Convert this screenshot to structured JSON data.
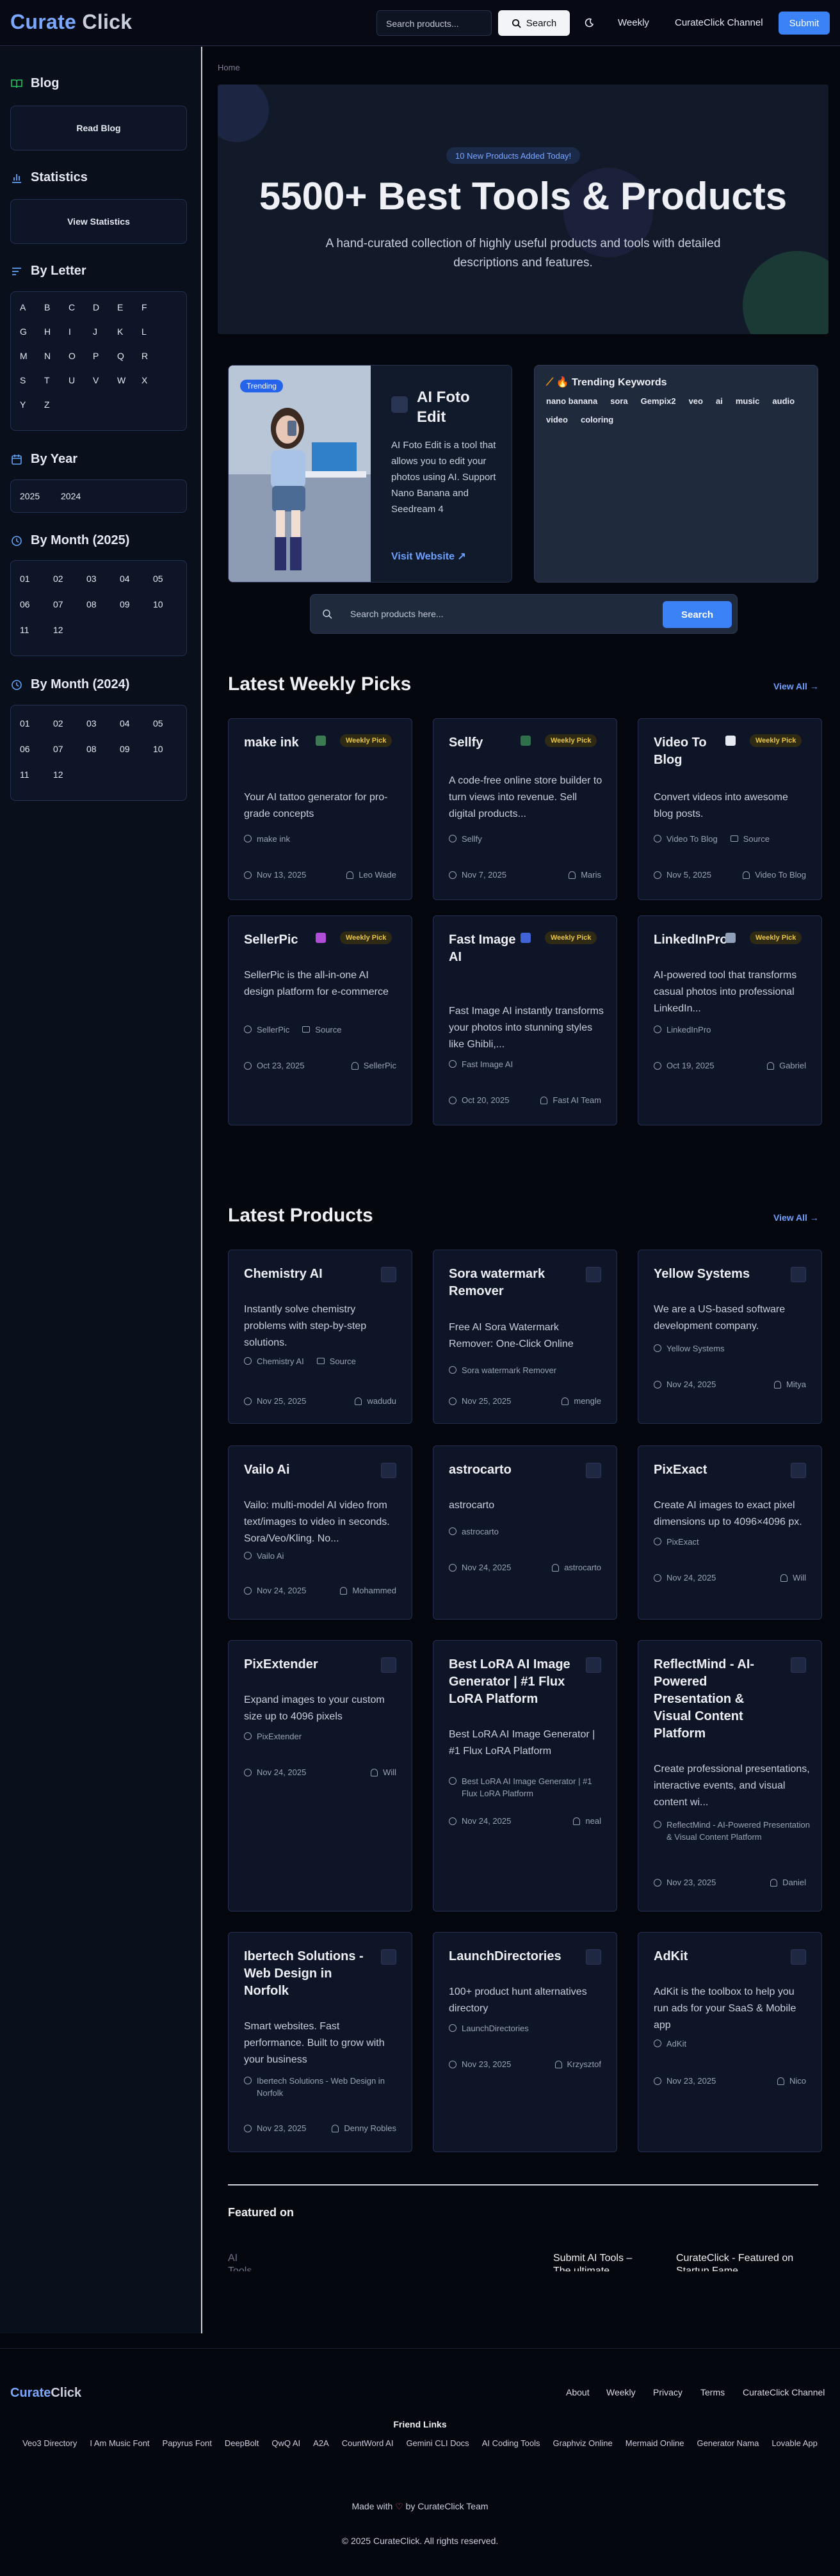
{
  "header": {
    "logo_part1": "Curate",
    "logo_part2": "Click",
    "search_placeholder": "Search products...",
    "search_button": "Search",
    "nav": [
      "Weekly",
      "CurateClick Channel"
    ],
    "submit": "Submit"
  },
  "sidebar": {
    "blog": {
      "title": "Blog",
      "button": "Read Blog"
    },
    "statistics": {
      "title": "Statistics",
      "button": "View Statistics"
    },
    "by_letter": {
      "title": "By Letter",
      "letters": [
        "A",
        "B",
        "C",
        "D",
        "E",
        "F",
        "G",
        "H",
        "I",
        "J",
        "K",
        "L",
        "M",
        "N",
        "O",
        "P",
        "Q",
        "R",
        "S",
        "T",
        "U",
        "V",
        "W",
        "X",
        "Y",
        "Z"
      ]
    },
    "by_year": {
      "title": "By Year",
      "years": [
        "2025",
        "2024"
      ]
    },
    "by_month_2025": {
      "title": "By Month (2025)",
      "months": [
        "01",
        "02",
        "03",
        "04",
        "05",
        "06",
        "07",
        "08",
        "09",
        "10",
        "11",
        "12"
      ]
    },
    "by_month_2024": {
      "title": "By Month (2024)",
      "months": [
        "01",
        "02",
        "03",
        "04",
        "05",
        "06",
        "07",
        "08",
        "09",
        "10",
        "11",
        "12"
      ]
    }
  },
  "breadcrumb": "Home",
  "hero": {
    "badge": "10 New Products Added Today!",
    "title": "5500+ Best Tools & Products",
    "subtitle": "A hand-curated collection of highly useful products and tools with detailed descriptions and features."
  },
  "featured_product": {
    "badge": "Trending",
    "title": "AI Foto Edit",
    "description": "AI Foto Edit is a tool that allows you to edit your photos using AI. Support Nano Banana and Seedream 4",
    "link": "Visit Website ↗"
  },
  "trending": {
    "title": "🔥 Trending Keywords",
    "keywords": [
      "nano banana",
      "sora",
      "Gempix2",
      "veo",
      "ai",
      "music",
      "audio",
      "video",
      "coloring"
    ]
  },
  "main_search": {
    "placeholder": "Search products here...",
    "button": "Search"
  },
  "weekly": {
    "title": "Latest Weekly Picks",
    "view_all": "View All →",
    "pill": "Weekly Pick",
    "cards": [
      {
        "title": "make ink",
        "description": "Your AI tattoo generator for pro-grade concepts",
        "tag": "make ink",
        "source": "",
        "date": "Nov 13, 2025",
        "author": "Leo Wade",
        "icon_color": "#3c7a52"
      },
      {
        "title": "Sellfy",
        "description": "A code-free online store builder to turn views into revenue. Sell digital products...",
        "tag": "Sellfy",
        "source": "",
        "date": "Nov 7, 2025",
        "author": "Maris",
        "icon_color": "#2f6f4a"
      },
      {
        "title": "Video To Blog",
        "description": "Convert videos into awesome blog posts.",
        "tag": "Video To Blog",
        "source": "Source",
        "date": "Nov 5, 2025",
        "author": "Video To Blog",
        "icon_color": "#e6e9f2"
      },
      {
        "title": "SellerPic",
        "description": "SellerPic is the all-in-one AI design platform for e-commerce",
        "tag": "SellerPic",
        "source": "Source",
        "date": "Oct 23, 2025",
        "author": "SellerPic",
        "icon_color": "#b04ed8"
      },
      {
        "title": "Fast Image AI",
        "description": "Fast Image AI instantly transforms your photos into stunning styles like Ghibli,...",
        "tag": "Fast Image AI",
        "source": "",
        "date": "Oct 20, 2025",
        "author": "Fast AI Team",
        "icon_color": "#4063d8"
      },
      {
        "title": "LinkedInPro",
        "description": "AI-powered tool that transforms casual photos into professional LinkedIn...",
        "tag": "LinkedInPro",
        "source": "",
        "date": "Oct 19, 2025",
        "author": "Gabriel",
        "icon_color": "#8fa0b8"
      }
    ]
  },
  "latest": {
    "title": "Latest Products",
    "view_all": "View All →",
    "cards": [
      {
        "title": "Chemistry AI",
        "description": "Instantly solve chemistry problems with step-by-step solutions.",
        "tag": "Chemistry AI",
        "source": "Source",
        "date": "Nov 25, 2025",
        "author": "wadudu"
      },
      {
        "title": "Sora watermark Remover",
        "description": "Free AI Sora Watermark Remover: One-Click Online",
        "tag": "Sora watermark Remover",
        "source": "",
        "date": "Nov 25, 2025",
        "author": "mengle"
      },
      {
        "title": "Yellow Systems",
        "description": "We are a US-based software development company.",
        "tag": "Yellow Systems",
        "source": "",
        "date": "Nov 24, 2025",
        "author": "Mitya"
      },
      {
        "title": "Vailo Ai",
        "description": "Vailo: multi-model AI video from text/images to video in seconds. Sora/Veo/Kling. No...",
        "tag": "Vailo Ai",
        "source": "",
        "date": "Nov 24, 2025",
        "author": "Mohammed"
      },
      {
        "title": "astrocarto",
        "description": "astrocarto",
        "tag": "astrocarto",
        "source": "",
        "date": "Nov 24, 2025",
        "author": "astrocarto"
      },
      {
        "title": "PixExact",
        "description": "Create AI images to exact pixel dimensions up to 4096×4096 px.",
        "tag": "PixExact",
        "source": "",
        "date": "Nov 24, 2025",
        "author": "Will"
      },
      {
        "title": "PixExtender",
        "description": "Expand images to your custom size up to 4096 pixels",
        "tag": "PixExtender",
        "source": "",
        "date": "Nov 24, 2025",
        "author": "Will"
      },
      {
        "title": "Best LoRA AI Image Generator | #1 Flux LoRA Platform",
        "description": "Best LoRA AI Image Generator | #1 Flux LoRA Platform",
        "tag": "Best LoRA AI Image Generator | #1 Flux LoRA Platform",
        "source": "",
        "date": "Nov 24, 2025",
        "author": "neal"
      },
      {
        "title": "ReflectMind - AI-Powered Presentation & Visual Content Platform",
        "description": "Create professional presentations, interactive events, and visual content wi...",
        "tag": "ReflectMind - AI-Powered Presentation & Visual Content Platform",
        "source": "",
        "date": "Nov 23, 2025",
        "author": "Daniel"
      },
      {
        "title": "Ibertech Solutions - Web Design in Norfolk",
        "description": "Smart websites. Fast performance. Built to grow with your business",
        "tag": "Ibertech Solutions - Web Design in Norfolk",
        "source": "",
        "date": "Nov 23, 2025",
        "author": "Denny Robles"
      },
      {
        "title": "LaunchDirectories",
        "description": "100+ product hunt alternatives directory",
        "tag": "LaunchDirectories",
        "source": "",
        "date": "Nov 23, 2025",
        "author": "Krzysztof"
      },
      {
        "title": "AdKit",
        "description": "AdKit is the toolbox to help you run ads for your SaaS & Mobile app",
        "tag": "AdKit",
        "source": "",
        "date": "Nov 23, 2025",
        "author": "Nico"
      }
    ]
  },
  "featured_on": {
    "title": "Featured on",
    "items": [
      "AI Tools",
      "Submit AI Tools – The ultimate",
      "CurateClick - Featured on Startup Fame"
    ]
  },
  "footer": {
    "logo_part1": "Curate",
    "logo_part2": "Click",
    "nav": [
      "About",
      "Weekly",
      "Privacy",
      "Terms",
      "CurateClick Channel"
    ],
    "friend_links_title": "Friend Links",
    "friend_links": [
      "Veo3 Directory",
      "I Am Music Font",
      "Papyrus Font",
      "DeepBolt",
      "QwQ AI",
      "A2A",
      "CountWord AI",
      "Gemini CLI Docs",
      "AI Coding Tools",
      "Graphviz Online",
      "Mermaid Online",
      "Generator Nama",
      "Lovable App"
    ],
    "made_with": "Made with",
    "heart": "♡",
    "made_by": "by CurateClick Team",
    "copyright": "© 2025 CurateClick. All rights reserved."
  }
}
